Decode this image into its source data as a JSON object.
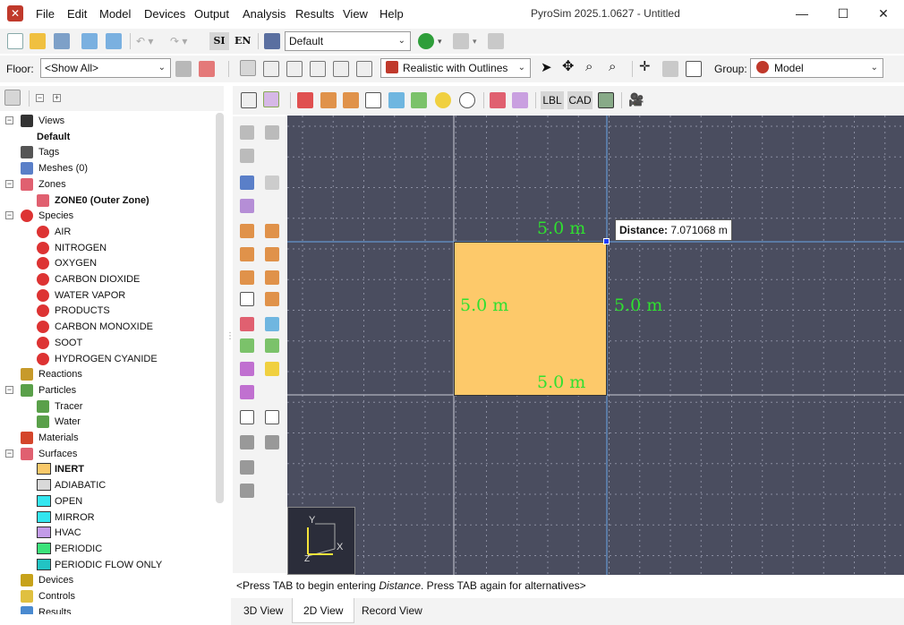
{
  "app": {
    "title": "PyroSim 2025.1.0627 - Untitled",
    "menu": [
      "File",
      "Edit",
      "Model",
      "Devices",
      "Output",
      "Analysis",
      "Results",
      "View",
      "Help"
    ]
  },
  "toolbar": {
    "unit_si": "SI",
    "unit_en": "EN",
    "view_select": "Default",
    "floor_label": "Floor:",
    "floor_select": "<Show All>",
    "render_mode": "Realistic with Outlines",
    "group_label": "Group:",
    "group_select": "Model",
    "lbl_button": "LBL",
    "cad_button": "CAD"
  },
  "tree": {
    "rows": [
      {
        "label": "Views",
        "level": 0,
        "expander": "−",
        "icon": "camera-icon",
        "bold": false
      },
      {
        "label": "Default",
        "level": 1,
        "expander": "",
        "icon": "",
        "bold": true
      },
      {
        "label": "Tags",
        "level": 0,
        "expander": "",
        "icon": "tag-icon",
        "bold": false
      },
      {
        "label": "Meshes (0)",
        "level": 0,
        "expander": "",
        "icon": "mesh-icon",
        "bold": false
      },
      {
        "label": "Zones",
        "level": 0,
        "expander": "−",
        "icon": "zone-icon",
        "bold": false
      },
      {
        "label": "ZONE0 (Outer Zone)",
        "level": 1,
        "expander": "",
        "icon": "zone-icon",
        "bold": true
      },
      {
        "label": "Species",
        "level": 0,
        "expander": "−",
        "icon": "molecule-icon",
        "bold": false
      },
      {
        "label": "AIR",
        "level": 1,
        "expander": "",
        "icon": "molecule-icon",
        "bold": false
      },
      {
        "label": "NITROGEN",
        "level": 1,
        "expander": "",
        "icon": "molecule-icon",
        "bold": false
      },
      {
        "label": "OXYGEN",
        "level": 1,
        "expander": "",
        "icon": "molecule-icon",
        "bold": false
      },
      {
        "label": "CARBON DIOXIDE",
        "level": 1,
        "expander": "",
        "icon": "molecule-icon",
        "bold": false
      },
      {
        "label": "WATER VAPOR",
        "level": 1,
        "expander": "",
        "icon": "molecule-icon",
        "bold": false
      },
      {
        "label": "PRODUCTS",
        "level": 1,
        "expander": "",
        "icon": "molecule-icon",
        "bold": false
      },
      {
        "label": "CARBON MONOXIDE",
        "level": 1,
        "expander": "",
        "icon": "molecule-icon",
        "bold": false
      },
      {
        "label": "SOOT",
        "level": 1,
        "expander": "",
        "icon": "molecule-icon",
        "bold": false
      },
      {
        "label": "HYDROGEN CYANIDE",
        "level": 1,
        "expander": "",
        "icon": "molecule-icon",
        "bold": false
      },
      {
        "label": "Reactions",
        "level": 0,
        "expander": "",
        "icon": "reaction-icon",
        "bold": false
      },
      {
        "label": "Particles",
        "level": 0,
        "expander": "−",
        "icon": "particles-icon",
        "bold": false
      },
      {
        "label": "Tracer",
        "level": 1,
        "expander": "",
        "icon": "particles-icon",
        "bold": false
      },
      {
        "label": "Water",
        "level": 1,
        "expander": "",
        "icon": "particles-icon",
        "bold": false
      },
      {
        "label": "Materials",
        "level": 0,
        "expander": "",
        "icon": "materials-icon",
        "bold": false
      },
      {
        "label": "Surfaces",
        "level": 0,
        "expander": "−",
        "icon": "surface-icon",
        "bold": false
      },
      {
        "label": "INERT",
        "level": 1,
        "expander": "",
        "icon": "swatch",
        "swatch": "#f9c96a",
        "bold": true
      },
      {
        "label": "ADIABATIC",
        "level": 1,
        "expander": "",
        "icon": "swatch",
        "swatch": "#d9d9d9",
        "bold": false
      },
      {
        "label": "OPEN",
        "level": 1,
        "expander": "",
        "icon": "swatch",
        "swatch": "#33e6f0",
        "bold": false
      },
      {
        "label": "MIRROR",
        "level": 1,
        "expander": "",
        "icon": "swatch",
        "swatch": "#33e6f0",
        "bold": false
      },
      {
        "label": "HVAC",
        "level": 1,
        "expander": "",
        "icon": "swatch",
        "swatch": "#c39be8",
        "bold": false
      },
      {
        "label": "PERIODIC",
        "level": 1,
        "expander": "",
        "icon": "swatch",
        "swatch": "#3be37a",
        "bold": false
      },
      {
        "label": "PERIODIC FLOW ONLY",
        "level": 1,
        "expander": "",
        "icon": "swatch",
        "swatch": "#22c4c4",
        "bold": false
      },
      {
        "label": "Devices",
        "level": 0,
        "expander": "",
        "icon": "device-icon",
        "bold": false
      },
      {
        "label": "Controls",
        "level": 0,
        "expander": "",
        "icon": "control-icon",
        "bold": false
      },
      {
        "label": "Results",
        "level": 0,
        "expander": "",
        "icon": "results-icon",
        "bold": false
      }
    ]
  },
  "canvas": {
    "dim_top": "5.0 m",
    "dim_left": "5.0 m",
    "dim_right": "5.0 m",
    "dim_bottom": "5.0 m",
    "tooltip_label": "Distance:",
    "tooltip_value": "7.071068 m",
    "axis_x": "X",
    "axis_y": "Y",
    "axis_z": "Z"
  },
  "status": {
    "pre": "<Press TAB to begin entering ",
    "em": "Distance",
    "post": ". Press TAB again for alternatives>"
  },
  "tabs": [
    "3D View",
    "2D View",
    "Record View"
  ],
  "colors": {
    "canvas_bg": "#4a4d5f",
    "block_fill": "#fdc96a",
    "dimension_text": "#2fe02f",
    "guide_line": "#6aa6e8",
    "accent_red": "#c0392b"
  }
}
